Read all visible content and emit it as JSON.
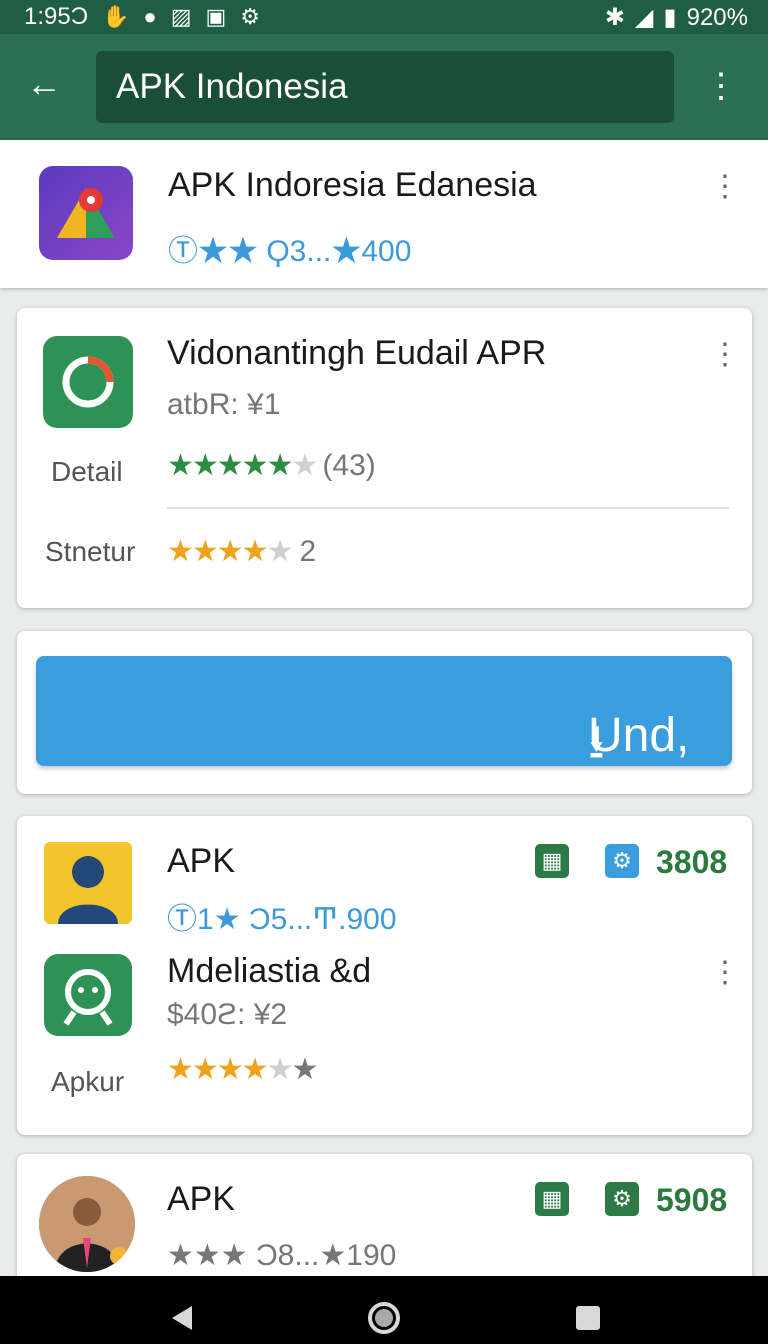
{
  "status_bar": {
    "time": "1:95Ͻ",
    "battery": "920%"
  },
  "app_bar": {
    "search_value": "APK Indonesia"
  },
  "top_item": {
    "title": "APK Indoresia Edanesia",
    "meta": "Ⓣ★★ Ϙ3...★400"
  },
  "detail_card": {
    "title": "Vidonantingh Eudail APR",
    "subtitle": "atbR: ¥1",
    "detail_label": "Detail",
    "rating_count": "(43)",
    "rating2_label": "Stnetur",
    "rating2_value": "2"
  },
  "download_button": {
    "label": "Und,"
  },
  "list_card": {
    "item1": {
      "title": "APK",
      "meta": "Ⓣ1★ Ͻ5...Ͳ.900",
      "count": "3808"
    },
    "item2": {
      "title": "Mdeliastia &d",
      "subtitle": "$40ϩ: ¥2",
      "label": "Apkur"
    }
  },
  "bottom_card": {
    "title": "APK",
    "meta": "★★★ Ͻ8...★190",
    "count": "5908"
  },
  "colors": {
    "appbar": "#2b7052",
    "statusbar": "#1f5e44",
    "accent_blue": "#3a9ddd",
    "green": "#2c8c3f"
  }
}
